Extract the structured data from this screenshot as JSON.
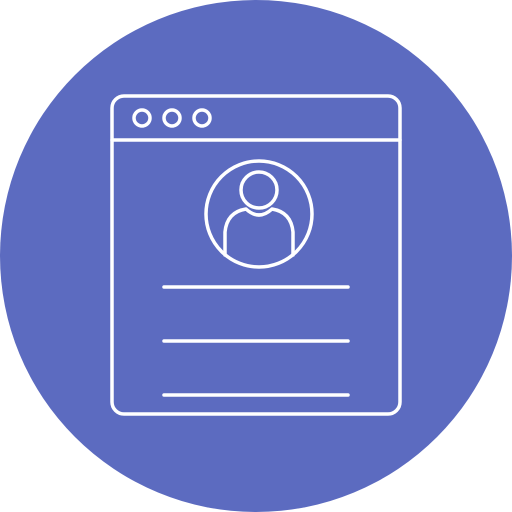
{
  "icon": {
    "name": "profile-webpage-icon",
    "background_color": "#5C6BC0",
    "line_color": "#FFFFFF",
    "elements": {
      "window_dots": [
        "window-dot-icon",
        "window-dot-icon",
        "window-dot-icon"
      ],
      "avatar": "user-avatar-icon",
      "text_lines": 3
    }
  }
}
